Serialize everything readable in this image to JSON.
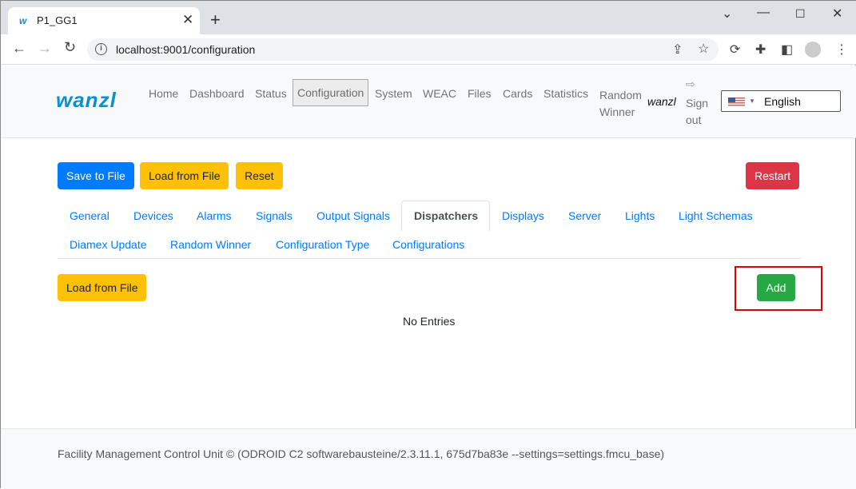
{
  "browser": {
    "tab_title": "P1_GG1",
    "url": "localhost:9001/configuration"
  },
  "header": {
    "logo": "wanzl",
    "nav": [
      "Home",
      "Dashboard",
      "Status",
      "Configuration",
      "System",
      "WEAC",
      "Files",
      "Cards",
      "Statistics"
    ],
    "random_winner": [
      "Random",
      "Winner"
    ],
    "user": "wanzl",
    "sign_out": [
      "Sign",
      "out"
    ],
    "language": "English"
  },
  "toolbar": {
    "save": "Save to File",
    "load": "Load from File",
    "reset": "Reset",
    "restart": "Restart"
  },
  "tabs": [
    "General",
    "Devices",
    "Alarms",
    "Signals",
    "Output Signals",
    "Dispatchers",
    "Displays",
    "Server",
    "Lights",
    "Light Schemas",
    "Diamex Update",
    "Random Winner",
    "Configuration Type",
    "Configurations"
  ],
  "active_tab": "Dispatchers",
  "panel": {
    "load": "Load from File",
    "add": "Add",
    "empty": "No Entries"
  },
  "footer": "Facility Management Control Unit © (ODROID C2 softwarebausteine/2.3.11.1, 675d7ba83e --settings=settings.fmcu_base)",
  "colors": {
    "primary": "#007bff",
    "warning": "#ffc107",
    "danger": "#dc3545",
    "success": "#28a745",
    "highlight": "#e00000"
  }
}
